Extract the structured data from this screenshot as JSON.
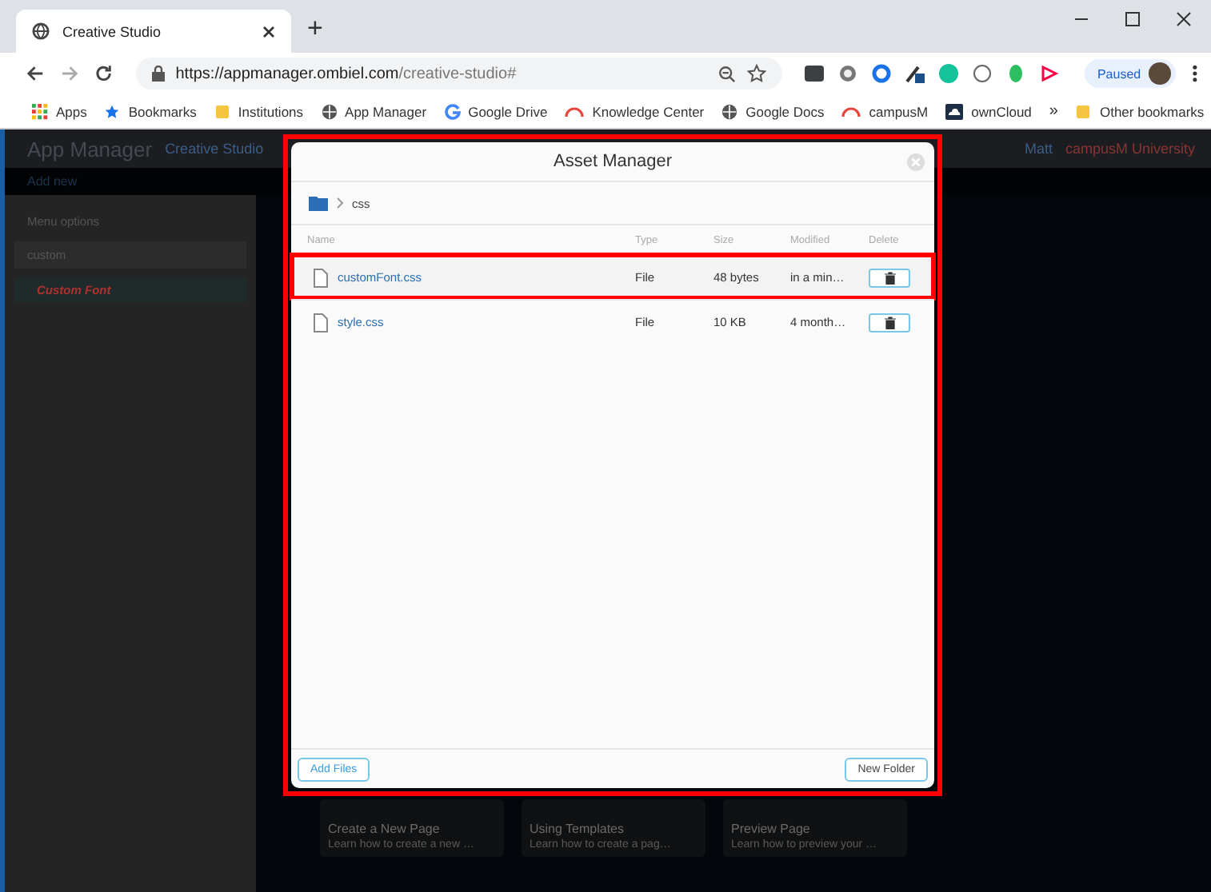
{
  "browser": {
    "tab_title": "Creative Studio",
    "new_tab": "+",
    "url_host": "https://appmanager.ombiel.com",
    "url_path": "/creative-studio#",
    "profile": "Paused",
    "bookmarks": [
      {
        "label": "Apps",
        "kind": "apps"
      },
      {
        "label": "Bookmarks",
        "kind": "star"
      },
      {
        "label": "Institutions",
        "kind": "folder"
      },
      {
        "label": "App Manager",
        "kind": "globe"
      },
      {
        "label": "Google Drive",
        "kind": "g"
      },
      {
        "label": "Knowledge Center",
        "kind": "arc"
      },
      {
        "label": "Google Docs",
        "kind": "globe"
      },
      {
        "label": "campusM",
        "kind": "arc"
      },
      {
        "label": "ownCloud",
        "kind": "cloud"
      }
    ],
    "more": "»",
    "other": "Other bookmarks"
  },
  "app": {
    "title": "App Manager",
    "subtitle": "Creative Studio",
    "user": "Matt",
    "institution": "campusM University",
    "add_new": "Add new",
    "sidebar": {
      "menu": "Menu options",
      "search": "custom",
      "items": [
        {
          "label": "Custom Font",
          "selected": true
        }
      ]
    },
    "cards": [
      {
        "title": "Create a New Page",
        "text": "Learn how to create a new …"
      },
      {
        "title": "Using Templates",
        "text": "Learn how to create a pag…"
      },
      {
        "title": "Preview Page",
        "text": "Learn how to preview your …"
      }
    ]
  },
  "modal": {
    "title": "Asset Manager",
    "highlighted": true,
    "breadcrumb": [
      "css"
    ],
    "columns": [
      "Name",
      "Type",
      "Size",
      "Modified",
      "Delete"
    ],
    "rows": [
      {
        "name": "customFont.css",
        "type": "File",
        "size": "48 bytes",
        "modified": "in a min…",
        "highlighted": true
      },
      {
        "name": "style.css",
        "type": "File",
        "size": "10 KB",
        "modified": "4 month…",
        "highlighted": false
      }
    ],
    "add_files": "Add Files",
    "new_folder": "New Folder"
  }
}
